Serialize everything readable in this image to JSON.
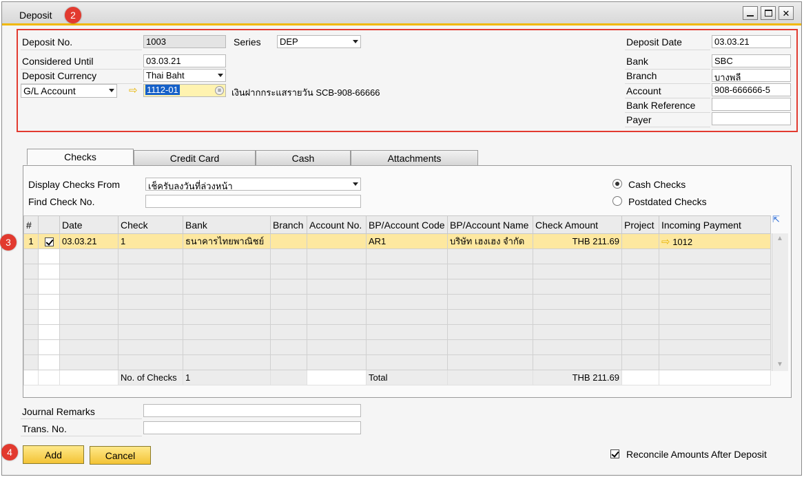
{
  "window": {
    "title": "Deposit",
    "buttons": [
      "minimize",
      "maximize",
      "close"
    ]
  },
  "badges": [
    "2",
    "3",
    "4"
  ],
  "header": {
    "deposit_no_label": "Deposit No.",
    "deposit_no": "1003",
    "series_label": "Series",
    "series": "DEP",
    "considered_until_label": "Considered Until",
    "considered_until": "03.03.21",
    "deposit_currency_label": "Deposit Currency",
    "deposit_currency": "Thai Baht",
    "gl_account_select": "G/L Account",
    "gl_account_code": "1112-01",
    "gl_account_name": "เงินฝากกระแสรายวัน SCB-908-66666",
    "deposit_date_label": "Deposit Date",
    "deposit_date": "03.03.21",
    "bank_label": "Bank",
    "bank": "SBC",
    "branch_label": "Branch",
    "branch": "บางพลี",
    "account_label": "Account",
    "account": "908-666666-5",
    "bank_reference_label": "Bank Reference",
    "bank_reference": "",
    "payer_label": "Payer",
    "payer": ""
  },
  "tabs": [
    {
      "label": "Checks",
      "active": true
    },
    {
      "label": "Credit Card",
      "active": false
    },
    {
      "label": "Cash",
      "active": false
    },
    {
      "label": "Attachments",
      "active": false
    }
  ],
  "checks": {
    "display_from_label": "Display Checks From",
    "display_from_value": "เช็ครับลงวันที่ล่วงหน้า",
    "find_label": "Find Check No.",
    "find_value": "",
    "radio_cash": "Cash Checks",
    "radio_postdated": "Postdated Checks",
    "radio_selected": "Cash Checks",
    "columns": [
      "#",
      "",
      "Date",
      "Check",
      "Bank",
      "Branch",
      "Account No.",
      "BP/Account Code",
      "BP/Account Name",
      "Check Amount",
      "Project",
      "Incoming Payment"
    ],
    "rows": [
      {
        "num": "1",
        "checked": true,
        "date": "03.03.21",
        "check": "1",
        "bank": "ธนาคารไทยพาณิชย์",
        "branch": "",
        "account_no": "",
        "bp_code": "AR1",
        "bp_name": "บริษัท เฮงเฮง จำกัด",
        "amount": "THB 211.69",
        "project": "",
        "incoming_payment": "1012"
      }
    ],
    "footer": {
      "no_of_checks_label": "No. of Checks",
      "no_of_checks": "1",
      "total_label": "Total",
      "total": "THB 211.69"
    }
  },
  "bottom": {
    "journal_remarks_label": "Journal Remarks",
    "journal_remarks": "",
    "trans_no_label": "Trans. No.",
    "trans_no": "",
    "add_label": "Add",
    "cancel_label": "Cancel",
    "reconcile_label": "Reconcile Amounts After Deposit",
    "reconcile_checked": true
  },
  "colors": {
    "highlight_row": "#fde8a0",
    "button": "#f3c335",
    "annotation": "#e23a2f",
    "title_accent": "#f1b800"
  }
}
